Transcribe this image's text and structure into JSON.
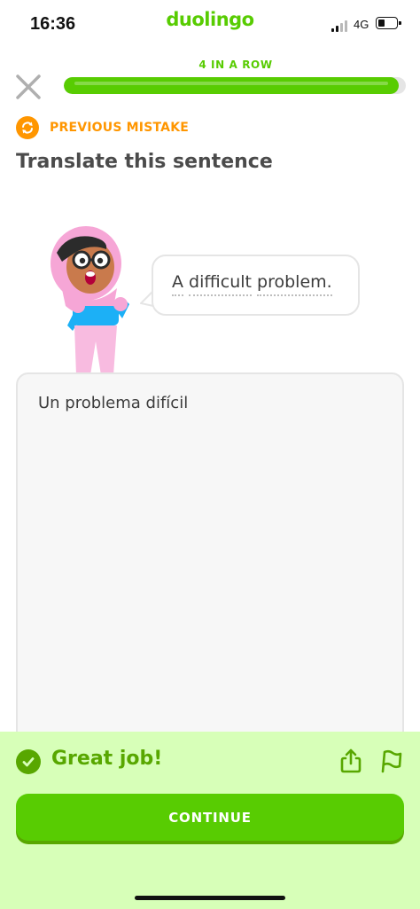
{
  "status_bar": {
    "time": "16:36",
    "app_name": "duolingo",
    "network": "4G"
  },
  "lesson": {
    "streak_label": "4 IN A ROW",
    "progress_fraction": 0.98,
    "previous_mistake_label": "PREVIOUS MISTAKE",
    "prompt_title": "Translate this sentence"
  },
  "exercise": {
    "sentence_words": [
      "A",
      "difficult",
      "problem."
    ],
    "answer": "Un problema difícil"
  },
  "feedback": {
    "title": "Great job!",
    "continue_label": "CONTINUE"
  },
  "colors": {
    "brand_green": "#58cc02",
    "dark_green": "#58a700",
    "feedback_bg": "#d7ffb8",
    "mistake_orange": "#ff9600"
  },
  "icons": [
    "close-icon",
    "refresh-icon",
    "check-icon",
    "share-icon",
    "flag-icon"
  ]
}
